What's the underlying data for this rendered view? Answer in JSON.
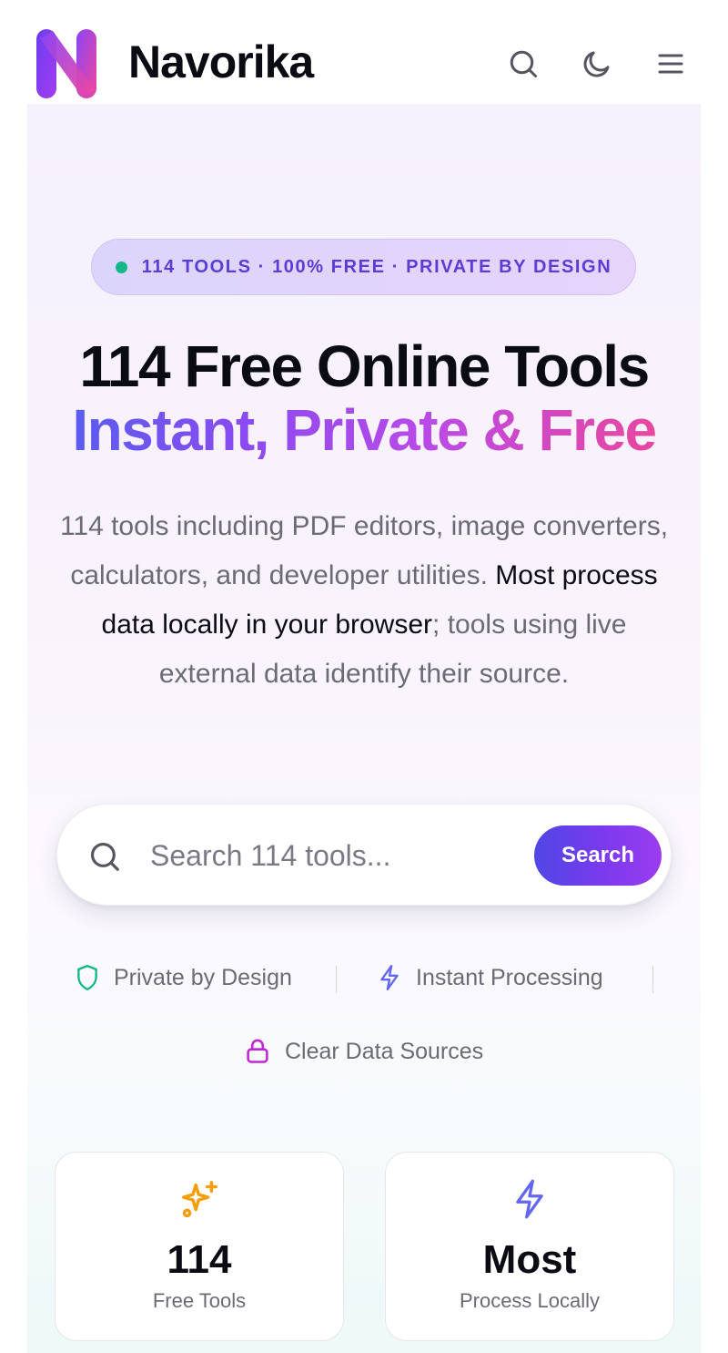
{
  "header": {
    "brand": "Navorika",
    "logo_icon": "navorika-n-logo",
    "actions": [
      "search-icon",
      "moon-icon",
      "menu-icon"
    ]
  },
  "hero": {
    "badge": "114 TOOLS · 100% FREE · PRIVATE BY DESIGN",
    "title_line1": "114 Free Online Tools",
    "title_line2": "Instant, Private & Free",
    "description": {
      "part1": "114 tools including PDF editors, image converters, calculators, and developer utilities.",
      "strong": "Most process data locally in your browser",
      "part2": "; tools using live external data identify their source."
    }
  },
  "search": {
    "placeholder": "Search 114 tools...",
    "value": "",
    "button_label": "Search"
  },
  "features": [
    {
      "label": "Private by Design",
      "icon": "shield-icon",
      "color": "#12b886"
    },
    {
      "label": "Instant Processing",
      "icon": "bolt-icon",
      "color": "#6366f1"
    },
    {
      "label": "Clear Data Sources",
      "icon": "lock-icon",
      "color": "#c026d3"
    }
  ],
  "stats": [
    {
      "value": "114",
      "label": "Free Tools",
      "icon": "sparkles-icon",
      "color": "#f59e0b"
    },
    {
      "value": "Most",
      "label": "Process Locally",
      "icon": "bolt-icon",
      "color": "#6366f1"
    }
  ],
  "colors": {
    "accent_start": "#4f46e5",
    "accent_end": "#9b3cf0",
    "pink": "#e8479e",
    "text_muted": "#6b6b76"
  }
}
